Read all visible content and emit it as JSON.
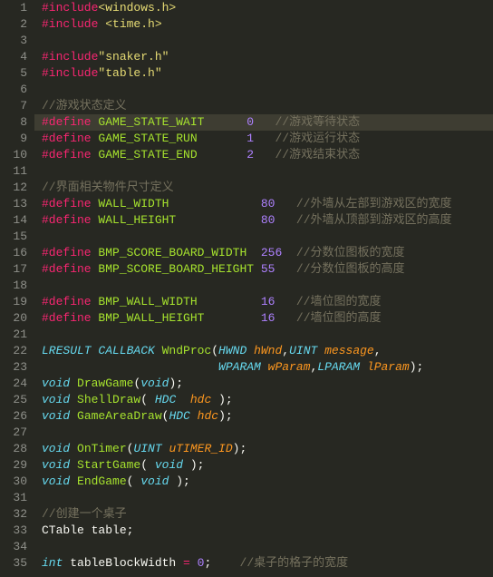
{
  "highlightedLine": 8,
  "lines": [
    {
      "n": 1,
      "tokens": [
        [
          "tok-preproc",
          "#include"
        ],
        [
          "tok-string",
          "<windows.h>"
        ]
      ]
    },
    {
      "n": 2,
      "tokens": [
        [
          "tok-preproc",
          "#include "
        ],
        [
          "tok-string",
          "<time.h>"
        ]
      ]
    },
    {
      "n": 3,
      "tokens": []
    },
    {
      "n": 4,
      "tokens": [
        [
          "tok-preproc",
          "#include"
        ],
        [
          "tok-string",
          "\"snaker.h\""
        ]
      ]
    },
    {
      "n": 5,
      "tokens": [
        [
          "tok-preproc",
          "#include"
        ],
        [
          "tok-string",
          "\"table.h\""
        ]
      ]
    },
    {
      "n": 6,
      "tokens": []
    },
    {
      "n": 7,
      "tokens": [
        [
          "tok-comment",
          "//游戏状态定义"
        ]
      ]
    },
    {
      "n": 8,
      "tokens": [
        [
          "tok-preproc",
          "#define "
        ],
        [
          "tok-macro",
          "GAME_STATE_WAIT"
        ],
        [
          "tok-ident",
          "      "
        ],
        [
          "tok-number",
          "0"
        ],
        [
          "tok-ident",
          "   "
        ],
        [
          "tok-comment",
          "//游戏等待状态"
        ]
      ]
    },
    {
      "n": 9,
      "tokens": [
        [
          "tok-preproc",
          "#define "
        ],
        [
          "tok-macro",
          "GAME_STATE_RUN"
        ],
        [
          "tok-ident",
          "       "
        ],
        [
          "tok-number",
          "1"
        ],
        [
          "tok-ident",
          "   "
        ],
        [
          "tok-comment",
          "//游戏运行状态"
        ]
      ]
    },
    {
      "n": 10,
      "tokens": [
        [
          "tok-preproc",
          "#define "
        ],
        [
          "tok-macro",
          "GAME_STATE_END"
        ],
        [
          "tok-ident",
          "       "
        ],
        [
          "tok-number",
          "2"
        ],
        [
          "tok-ident",
          "   "
        ],
        [
          "tok-comment",
          "//游戏结束状态"
        ]
      ]
    },
    {
      "n": 11,
      "tokens": []
    },
    {
      "n": 12,
      "tokens": [
        [
          "tok-comment",
          "//界面相关物件尺寸定义"
        ]
      ]
    },
    {
      "n": 13,
      "tokens": [
        [
          "tok-preproc",
          "#define "
        ],
        [
          "tok-macro",
          "WALL_WIDTH"
        ],
        [
          "tok-ident",
          "             "
        ],
        [
          "tok-number",
          "80"
        ],
        [
          "tok-ident",
          "   "
        ],
        [
          "tok-comment",
          "//外墙从左部到游戏区的宽度"
        ]
      ]
    },
    {
      "n": 14,
      "tokens": [
        [
          "tok-preproc",
          "#define "
        ],
        [
          "tok-macro",
          "WALL_HEIGHT"
        ],
        [
          "tok-ident",
          "            "
        ],
        [
          "tok-number",
          "80"
        ],
        [
          "tok-ident",
          "   "
        ],
        [
          "tok-comment",
          "//外墙从顶部到游戏区的高度"
        ]
      ]
    },
    {
      "n": 15,
      "tokens": []
    },
    {
      "n": 16,
      "tokens": [
        [
          "tok-preproc",
          "#define "
        ],
        [
          "tok-macro",
          "BMP_SCORE_BOARD_WIDTH"
        ],
        [
          "tok-ident",
          "  "
        ],
        [
          "tok-number",
          "256"
        ],
        [
          "tok-ident",
          "  "
        ],
        [
          "tok-comment",
          "//分数位图板的宽度"
        ]
      ]
    },
    {
      "n": 17,
      "tokens": [
        [
          "tok-preproc",
          "#define "
        ],
        [
          "tok-macro",
          "BMP_SCORE_BOARD_HEIGHT"
        ],
        [
          "tok-ident",
          " "
        ],
        [
          "tok-number",
          "55"
        ],
        [
          "tok-ident",
          "   "
        ],
        [
          "tok-comment",
          "//分数位图板的高度"
        ]
      ]
    },
    {
      "n": 18,
      "tokens": []
    },
    {
      "n": 19,
      "tokens": [
        [
          "tok-preproc",
          "#define "
        ],
        [
          "tok-macro",
          "BMP_WALL_WIDTH"
        ],
        [
          "tok-ident",
          "         "
        ],
        [
          "tok-number",
          "16"
        ],
        [
          "tok-ident",
          "   "
        ],
        [
          "tok-comment",
          "//墙位图的宽度"
        ]
      ]
    },
    {
      "n": 20,
      "tokens": [
        [
          "tok-preproc",
          "#define "
        ],
        [
          "tok-macro",
          "BMP_WALL_HEIGHT"
        ],
        [
          "tok-ident",
          "        "
        ],
        [
          "tok-number",
          "16"
        ],
        [
          "tok-ident",
          "   "
        ],
        [
          "tok-comment",
          "//墙位图的高度"
        ]
      ]
    },
    {
      "n": 21,
      "tokens": []
    },
    {
      "n": 22,
      "tokens": [
        [
          "tok-type",
          "LRESULT CALLBACK "
        ],
        [
          "tok-func",
          "WndProc"
        ],
        [
          "tok-punc",
          "("
        ],
        [
          "tok-type",
          "HWND "
        ],
        [
          "tok-param",
          "hWnd"
        ],
        [
          "tok-punc",
          ","
        ],
        [
          "tok-type",
          "UINT "
        ],
        [
          "tok-param",
          "message"
        ],
        [
          "tok-punc",
          ","
        ]
      ]
    },
    {
      "n": 23,
      "tokens": [
        [
          "tok-ident",
          "                         "
        ],
        [
          "tok-type",
          "WPARAM "
        ],
        [
          "tok-param",
          "wParam"
        ],
        [
          "tok-punc",
          ","
        ],
        [
          "tok-type",
          "LPARAM "
        ],
        [
          "tok-param",
          "lParam"
        ],
        [
          "tok-punc",
          ");"
        ]
      ]
    },
    {
      "n": 24,
      "tokens": [
        [
          "tok-type",
          "void "
        ],
        [
          "tok-func",
          "DrawGame"
        ],
        [
          "tok-punc",
          "("
        ],
        [
          "tok-type",
          "void"
        ],
        [
          "tok-punc",
          ");"
        ]
      ]
    },
    {
      "n": 25,
      "tokens": [
        [
          "tok-type",
          "void "
        ],
        [
          "tok-func",
          "ShellDraw"
        ],
        [
          "tok-punc",
          "( "
        ],
        [
          "tok-type",
          "HDC "
        ],
        [
          "tok-param",
          " hdc "
        ],
        [
          "tok-punc",
          ");"
        ]
      ]
    },
    {
      "n": 26,
      "tokens": [
        [
          "tok-type",
          "void "
        ],
        [
          "tok-func",
          "GameAreaDraw"
        ],
        [
          "tok-punc",
          "("
        ],
        [
          "tok-type",
          "HDC "
        ],
        [
          "tok-param",
          "hdc"
        ],
        [
          "tok-punc",
          ");"
        ]
      ]
    },
    {
      "n": 27,
      "tokens": []
    },
    {
      "n": 28,
      "tokens": [
        [
          "tok-type",
          "void "
        ],
        [
          "tok-func",
          "OnTimer"
        ],
        [
          "tok-punc",
          "("
        ],
        [
          "tok-type",
          "UINT "
        ],
        [
          "tok-param",
          "uTIMER_ID"
        ],
        [
          "tok-punc",
          ");"
        ]
      ]
    },
    {
      "n": 29,
      "tokens": [
        [
          "tok-type",
          "void "
        ],
        [
          "tok-func",
          "StartGame"
        ],
        [
          "tok-punc",
          "( "
        ],
        [
          "tok-type",
          "void"
        ],
        [
          "tok-punc",
          " );"
        ]
      ]
    },
    {
      "n": 30,
      "tokens": [
        [
          "tok-type",
          "void "
        ],
        [
          "tok-func",
          "EndGame"
        ],
        [
          "tok-punc",
          "( "
        ],
        [
          "tok-type",
          "void"
        ],
        [
          "tok-punc",
          " );"
        ]
      ]
    },
    {
      "n": 31,
      "tokens": []
    },
    {
      "n": 32,
      "tokens": [
        [
          "tok-comment",
          "//创建一个桌子"
        ]
      ]
    },
    {
      "n": 33,
      "tokens": [
        [
          "tok-ident",
          "CTable table;"
        ]
      ]
    },
    {
      "n": 34,
      "tokens": []
    },
    {
      "n": 35,
      "tokens": [
        [
          "tok-type",
          "int "
        ],
        [
          "tok-ident",
          "tableBlockWidth "
        ],
        [
          "tok-preproc",
          "="
        ],
        [
          "tok-ident",
          " "
        ],
        [
          "tok-number",
          "0"
        ],
        [
          "tok-punc",
          ";"
        ],
        [
          "tok-ident",
          "    "
        ],
        [
          "tok-comment",
          "//桌子的格子的宽度"
        ]
      ]
    }
  ]
}
